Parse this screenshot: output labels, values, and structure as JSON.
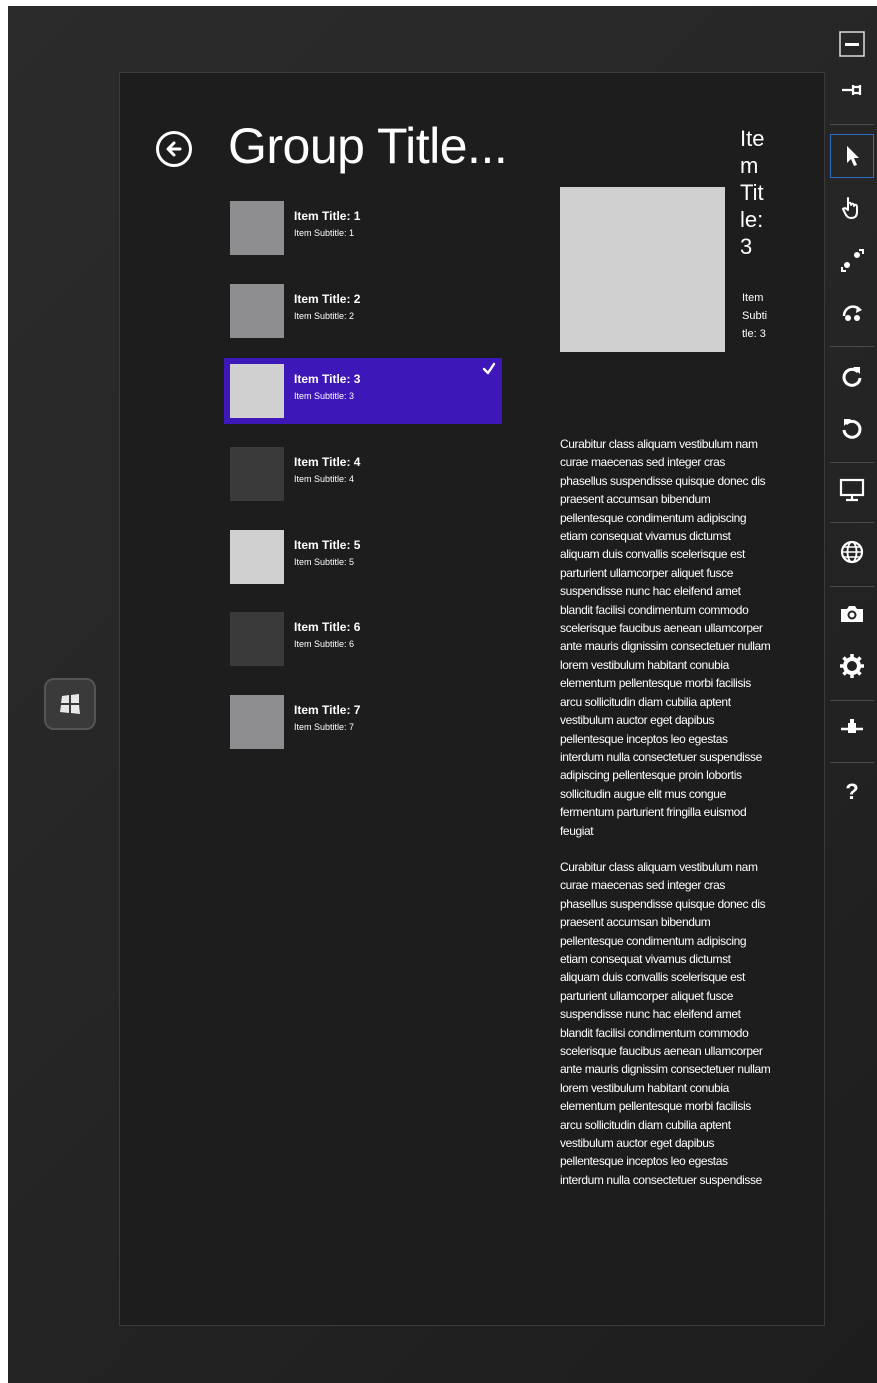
{
  "app": {
    "group_title": "Group Title...",
    "accent_color": "#3d17b8"
  },
  "items": [
    {
      "title": "Item Title: 1",
      "subtitle": "Item Subtitle: 1",
      "swatch": "#8e8e90",
      "selected": false
    },
    {
      "title": "Item Title: 2",
      "subtitle": "Item Subtitle: 2",
      "swatch": "#8e8e90",
      "selected": false
    },
    {
      "title": "Item Title: 3",
      "subtitle": "Item Subtitle: 3",
      "swatch": "#d0d0d1",
      "selected": true
    },
    {
      "title": "Item Title: 4",
      "subtitle": "Item Subtitle: 4",
      "swatch": "#3a3a3b",
      "selected": false
    },
    {
      "title": "Item Title: 5",
      "subtitle": "Item Subtitle: 5",
      "swatch": "#d0d0d1",
      "selected": false
    },
    {
      "title": "Item Title: 6",
      "subtitle": "Item Subtitle: 6",
      "swatch": "#3a3a3b",
      "selected": false
    },
    {
      "title": "Item Title: 7",
      "subtitle": "Item Subtitle: 7",
      "swatch": "#8e8e90",
      "selected": false
    }
  ],
  "detail": {
    "title": "Item Title: 3",
    "subtitle": "Item Subtitle: 3",
    "image_color": "#d0d0d1",
    "paragraphs": [
      "Curabitur class aliquam vestibulum nam curae maecenas sed integer cras phasellus suspendisse quisque donec dis praesent accumsan bibendum pellentesque condimentum adipiscing etiam consequat vivamus dictumst aliquam duis convallis scelerisque est parturient ullamcorper aliquet fusce suspendisse nunc hac eleifend amet blandit facilisi condimentum commodo scelerisque faucibus aenean ullamcorper ante mauris dignissim consectetuer nullam lorem vestibulum habitant conubia elementum pellentesque morbi facilisis arcu sollicitudin diam cubilia aptent vestibulum auctor eget dapibus pellentesque inceptos leo egestas interdum nulla consectetuer suspendisse adipiscing pellentesque proin lobortis sollicitudin augue elit mus congue fermentum parturient fringilla euismod feugiat",
      "Curabitur class aliquam vestibulum nam curae maecenas sed integer cras phasellus suspendisse quisque donec dis praesent accumsan bibendum pellentesque condimentum adipiscing etiam consequat vivamus dictumst aliquam duis convallis scelerisque est parturient ullamcorper aliquet fusce suspendisse nunc hac eleifend amet blandit facilisi condimentum commodo scelerisque faucibus aenean ullamcorper ante mauris dignissim consectetuer nullam lorem vestibulum habitant conubia elementum pellentesque morbi facilisis arcu sollicitudin diam cubilia aptent vestibulum auctor eget dapibus pellentesque inceptos leo egestas interdum nulla consectetuer suspendisse"
    ]
  },
  "toolbar": {
    "tools": [
      {
        "name": "minimize-icon"
      },
      {
        "name": "pin-icon"
      },
      {
        "name": "mouse-pointer-icon",
        "active": true
      },
      {
        "name": "touch-hand-icon"
      },
      {
        "name": "pinch-zoom-icon"
      },
      {
        "name": "rotation-gesture-icon"
      },
      {
        "name": "rotate-clockwise-icon"
      },
      {
        "name": "rotate-counterclockwise-icon"
      },
      {
        "name": "change-resolution-icon"
      },
      {
        "name": "set-location-icon"
      },
      {
        "name": "screenshot-camera-icon"
      },
      {
        "name": "settings-gear-icon"
      },
      {
        "name": "network-icon"
      },
      {
        "name": "help-icon"
      }
    ],
    "help_glyph": "?"
  }
}
